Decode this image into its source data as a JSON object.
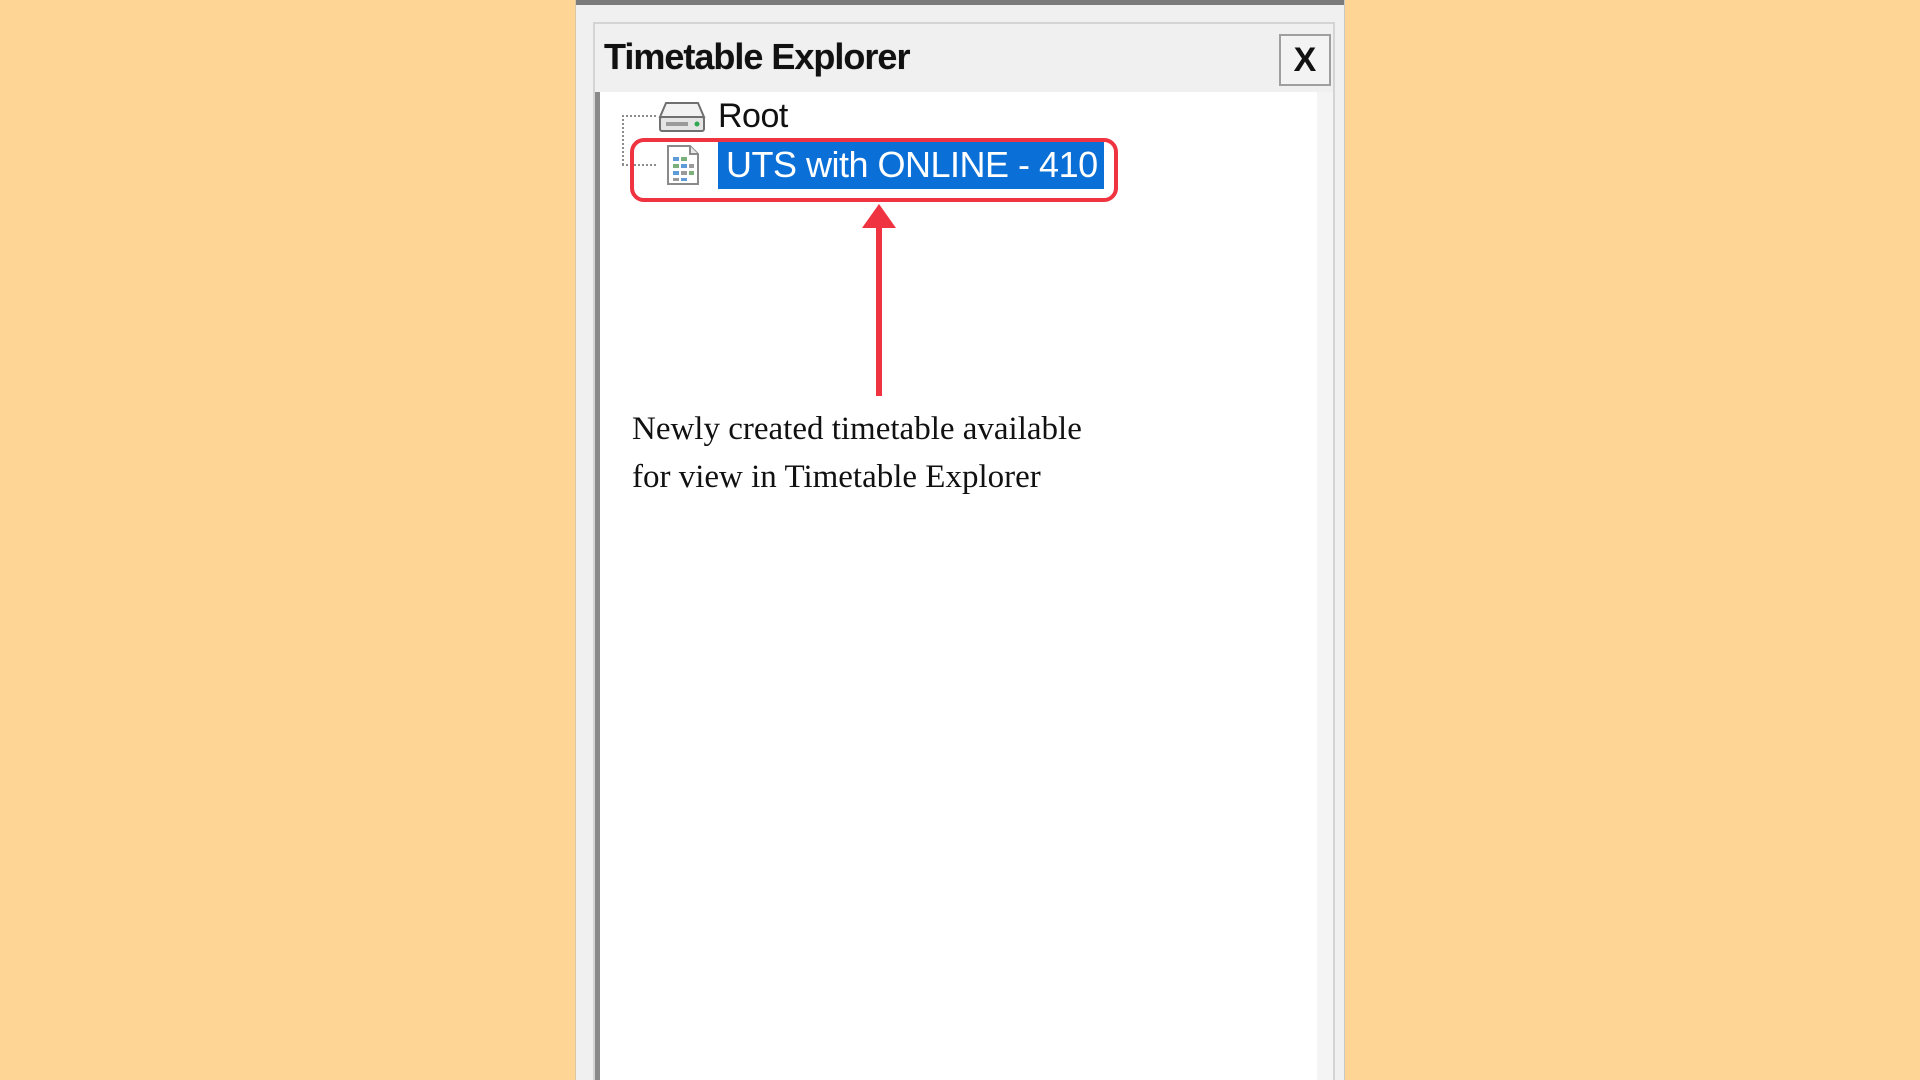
{
  "background_color": "#FFD595",
  "panel": {
    "title": "Timetable Explorer",
    "close_label": "X"
  },
  "tree": {
    "items": [
      {
        "label": "Root",
        "icon": "drive-icon",
        "selected": false
      },
      {
        "label": "UTS with ONLINE - 410",
        "icon": "timetable-document-icon",
        "selected": true
      }
    ]
  },
  "annotation": {
    "line1": "Newly created timetable available",
    "line2": "for view in Timetable Explorer",
    "color": "#EF3340"
  }
}
